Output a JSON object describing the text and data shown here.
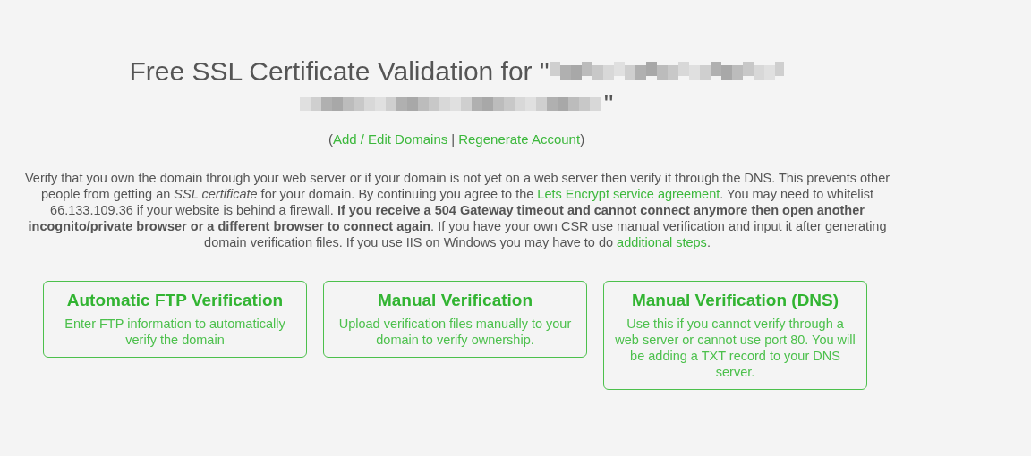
{
  "title": {
    "prefix": "Free SSL Certificate Validation for \"",
    "suffix": "\""
  },
  "account_links": {
    "open": "(",
    "close": ")",
    "separator": "|",
    "links": [
      "Add / Edit Domains",
      "Regenerate Account"
    ]
  },
  "intro": [
    {
      "kind": "text",
      "text": "Verify that you own the domain through your web server or if your domain is not yet on a web server then verify it through the DNS. This prevents other people from getting an *SSL certificate* for your domain. By continuing you agree to the "
    },
    {
      "kind": "link",
      "text": "Lets Encrypt service agreement"
    },
    {
      "kind": "text",
      "text": ". You may need to whitelist 66.133.109.36 if your website is behind a firewall. **If you receive a 504 Gateway timeout and cannot connect anymore then open another incognito/private browser or a different browser to connect again**. If you have your own CSR use manual verification and input it after generating domain verification files. If you use IIS on Windows you may have to do "
    },
    {
      "kind": "link",
      "text": "additional steps"
    },
    {
      "kind": "text",
      "text": "."
    }
  ],
  "options": [
    {
      "title": "Automatic FTP Verification",
      "description": "Enter FTP information to automatically verify the domain"
    },
    {
      "title": "Manual Verification",
      "description": "Upload verification files manually to your domain to verify ownership."
    },
    {
      "title": "Manual Verification (DNS)",
      "description": "Use this if you cannot verify through a web server or cannot use port 80. You will be adding a TXT record to your DNS server."
    }
  ]
}
